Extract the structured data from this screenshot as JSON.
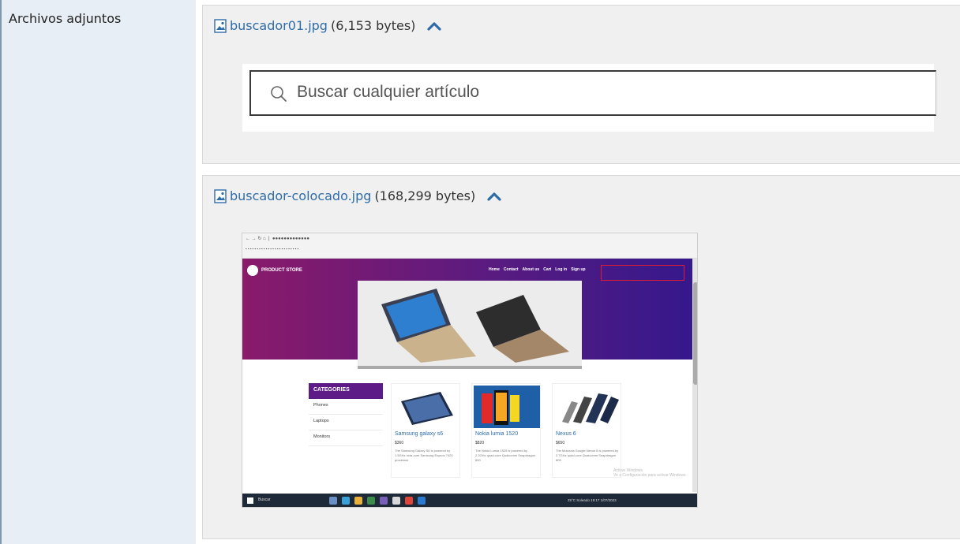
{
  "field_label": "Archivos adjuntos",
  "attachments": [
    {
      "filename": "buscador01.jpg",
      "size": "(6,153 bytes)",
      "preview": {
        "search_placeholder": "Buscar cualquier artículo"
      }
    },
    {
      "filename": "buscador-colocado.jpg",
      "size": "(168,299 bytes)",
      "preview": {
        "brand": "PRODUCT STORE",
        "nav": [
          "Home",
          "Contact",
          "About us",
          "Cart",
          "Log in",
          "Sign up"
        ],
        "categories_title": "CATEGORIES",
        "categories": [
          "Phones",
          "Laptops",
          "Monitors"
        ],
        "products": [
          {
            "name": "Samsung galaxy s6",
            "price": "$360",
            "desc": "The Samsung Galaxy S6 is powered by 1.5GHz octa-core Samsung Exynos 7420 processor"
          },
          {
            "name": "Nokia lumia 1520",
            "price": "$820",
            "desc": "The Nokia Lumia 1520 is powered by 2.2GHz quad-core Qualcomm Snapdragon 800"
          },
          {
            "name": "Nexus 6",
            "price": "$650",
            "desc": "The Motorola Google Nexus 6 is powered by 2.7GHz quad-core Qualcomm Snapdragon 805"
          }
        ],
        "watermark": "Activar Windows\nVe a Configuración para activar Windows.",
        "taskbar_search": "Buscar",
        "taskbar_tray": "25°C Soleado   19:17  1/07/2023"
      }
    }
  ],
  "colors": {
    "link": "#2d6ca8",
    "chevron": "#2d6ca8",
    "label_bg": "#e8eef5",
    "panel_bg": "#f0f0f0"
  },
  "icons": [
    "image-file-icon",
    "chevron-up-icon",
    "search-icon"
  ]
}
